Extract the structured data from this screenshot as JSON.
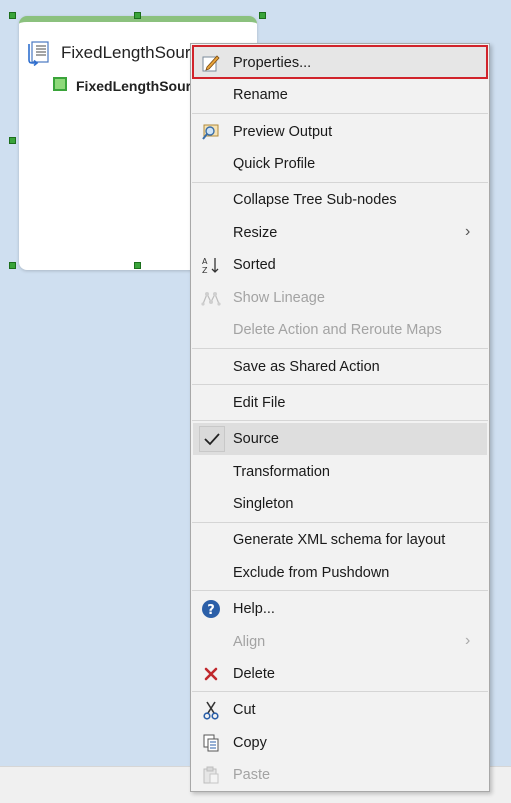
{
  "canvas": {
    "node_title": "FixedLengthSource",
    "node_sub": "FixedLengthSource"
  },
  "menu": {
    "items": [
      {
        "label": "Properties...",
        "icon": "properties-icon",
        "disabled": false
      },
      {
        "label": "Rename",
        "disabled": false
      },
      {
        "label": "Preview Output",
        "icon": "preview-output-icon",
        "disabled": false
      },
      {
        "label": "Quick Profile",
        "disabled": false
      },
      {
        "label": "Collapse Tree Sub-nodes",
        "disabled": false
      },
      {
        "label": "Resize",
        "disabled": false,
        "submenu": true
      },
      {
        "label": "Sorted",
        "icon": "sort-az-icon",
        "disabled": false
      },
      {
        "label": "Show Lineage",
        "icon": "lineage-icon",
        "disabled": true
      },
      {
        "label": "Delete Action and Reroute Maps",
        "disabled": true
      },
      {
        "label": "Save as Shared Action",
        "disabled": false
      },
      {
        "label": "Edit File",
        "disabled": false
      },
      {
        "label": "Source",
        "icon": "check-icon",
        "disabled": false,
        "checked": true
      },
      {
        "label": "Transformation",
        "disabled": false
      },
      {
        "label": "Singleton",
        "disabled": false
      },
      {
        "label": "Generate XML schema for layout",
        "disabled": false
      },
      {
        "label": "Exclude from Pushdown",
        "disabled": false
      },
      {
        "label": "Help...",
        "icon": "help-icon",
        "disabled": false
      },
      {
        "label": "Align",
        "disabled": true,
        "submenu": true
      },
      {
        "label": "Delete",
        "icon": "delete-icon",
        "disabled": false
      },
      {
        "label": "Cut",
        "icon": "cut-icon",
        "disabled": false
      },
      {
        "label": "Copy",
        "icon": "copy-icon",
        "disabled": false
      },
      {
        "label": "Paste",
        "icon": "paste-icon",
        "disabled": true
      }
    ]
  },
  "colors": {
    "background": "#cfdff0",
    "highlight_border": "#d1232b",
    "node_accent": "#8bc17e"
  }
}
